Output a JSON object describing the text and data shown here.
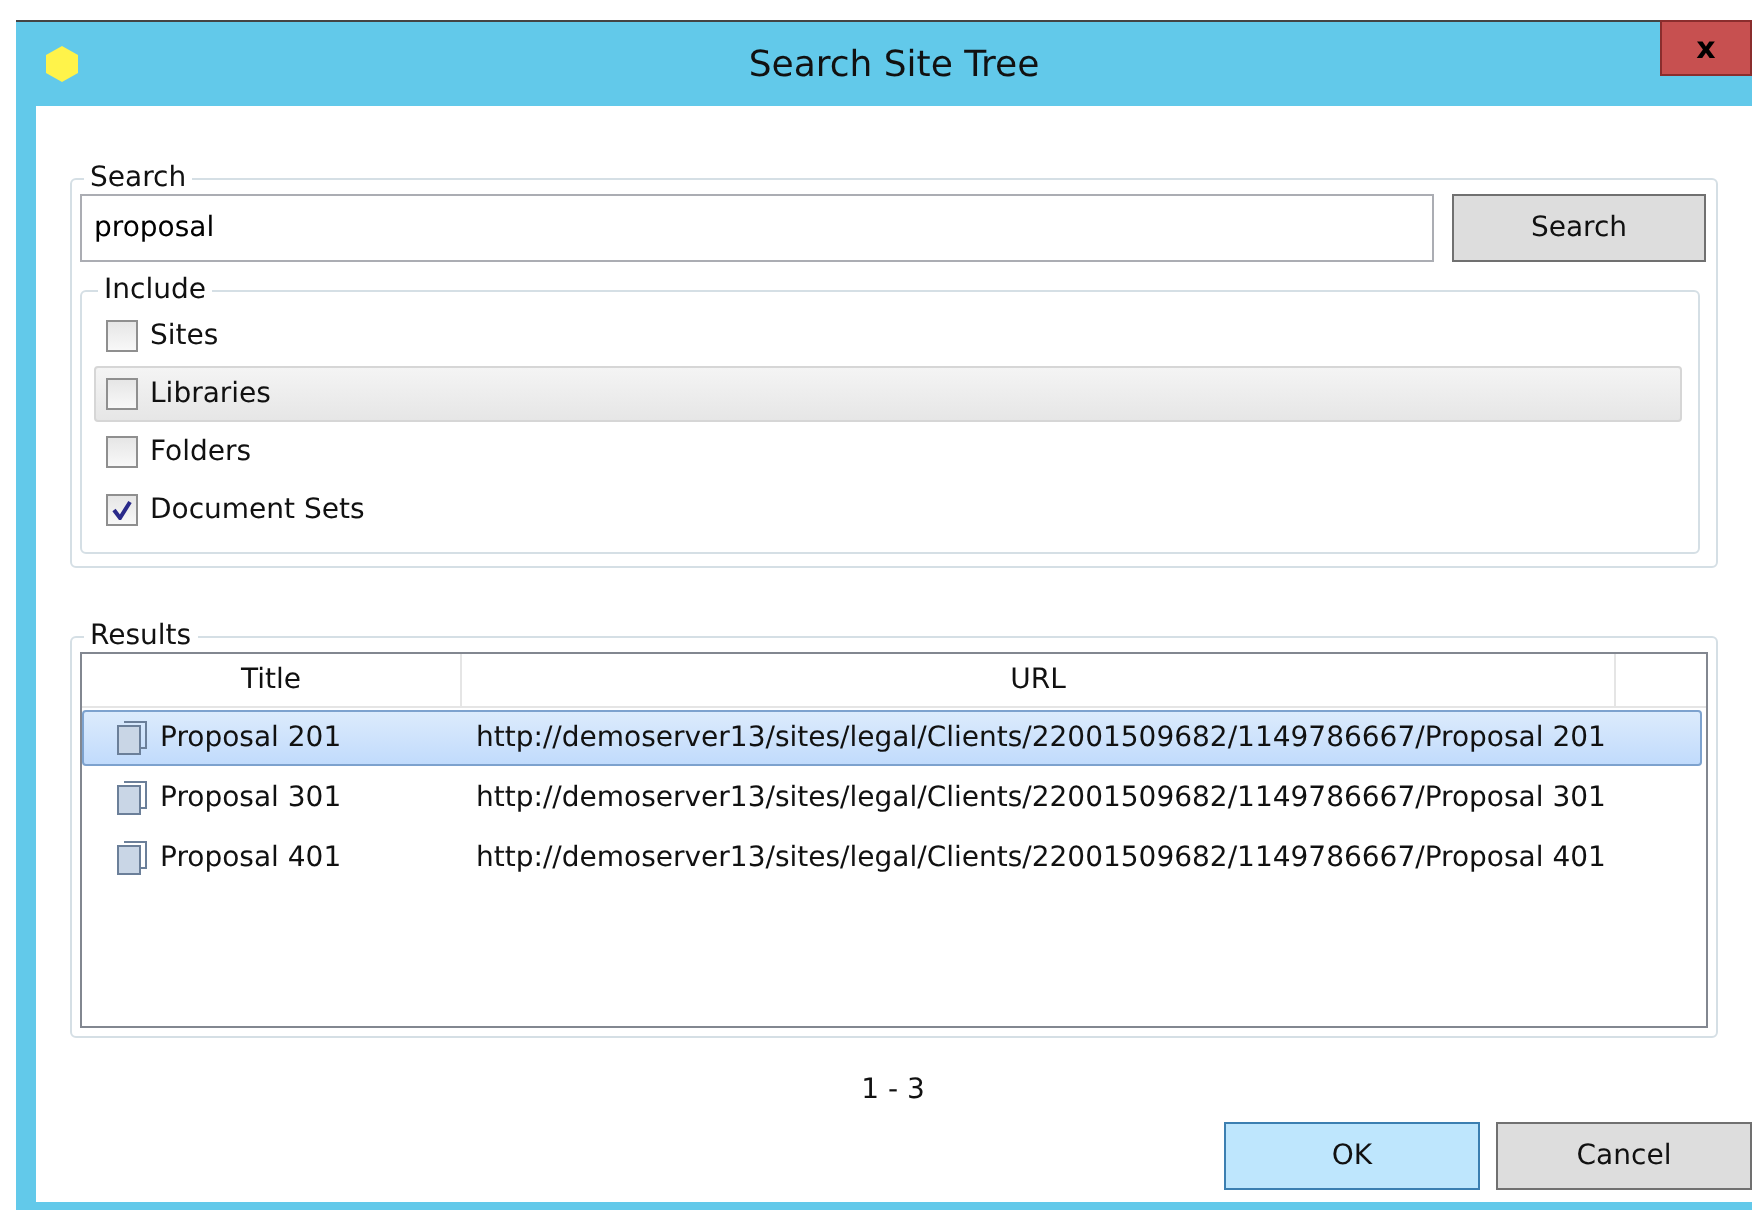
{
  "window": {
    "title": "Search Site Tree",
    "close": "x"
  },
  "search": {
    "legend": "Search",
    "value": "proposal",
    "button": "Search"
  },
  "include": {
    "legend": "Include",
    "items": [
      {
        "label": "Sites",
        "checked": false,
        "hovered": false
      },
      {
        "label": "Libraries",
        "checked": false,
        "hovered": true
      },
      {
        "label": "Folders",
        "checked": false,
        "hovered": false
      },
      {
        "label": "Document Sets",
        "checked": true,
        "hovered": false
      }
    ]
  },
  "results": {
    "legend": "Results",
    "columns": [
      "Title",
      "URL"
    ],
    "rows": [
      {
        "title": "Proposal 201",
        "url": "http://demoserver13/sites/legal/Clients/22001509682/1149786667/Proposal 201",
        "selected": true
      },
      {
        "title": "Proposal 301",
        "url": "http://demoserver13/sites/legal/Clients/22001509682/1149786667/Proposal 301",
        "selected": false
      },
      {
        "title": "Proposal 401",
        "url": "http://demoserver13/sites/legal/Clients/22001509682/1149786667/Proposal 401",
        "selected": false
      }
    ]
  },
  "count": "1 - 3",
  "buttons": [
    {
      "label": "OK",
      "default": true
    },
    {
      "label": "Cancel",
      "default": false
    }
  ]
}
